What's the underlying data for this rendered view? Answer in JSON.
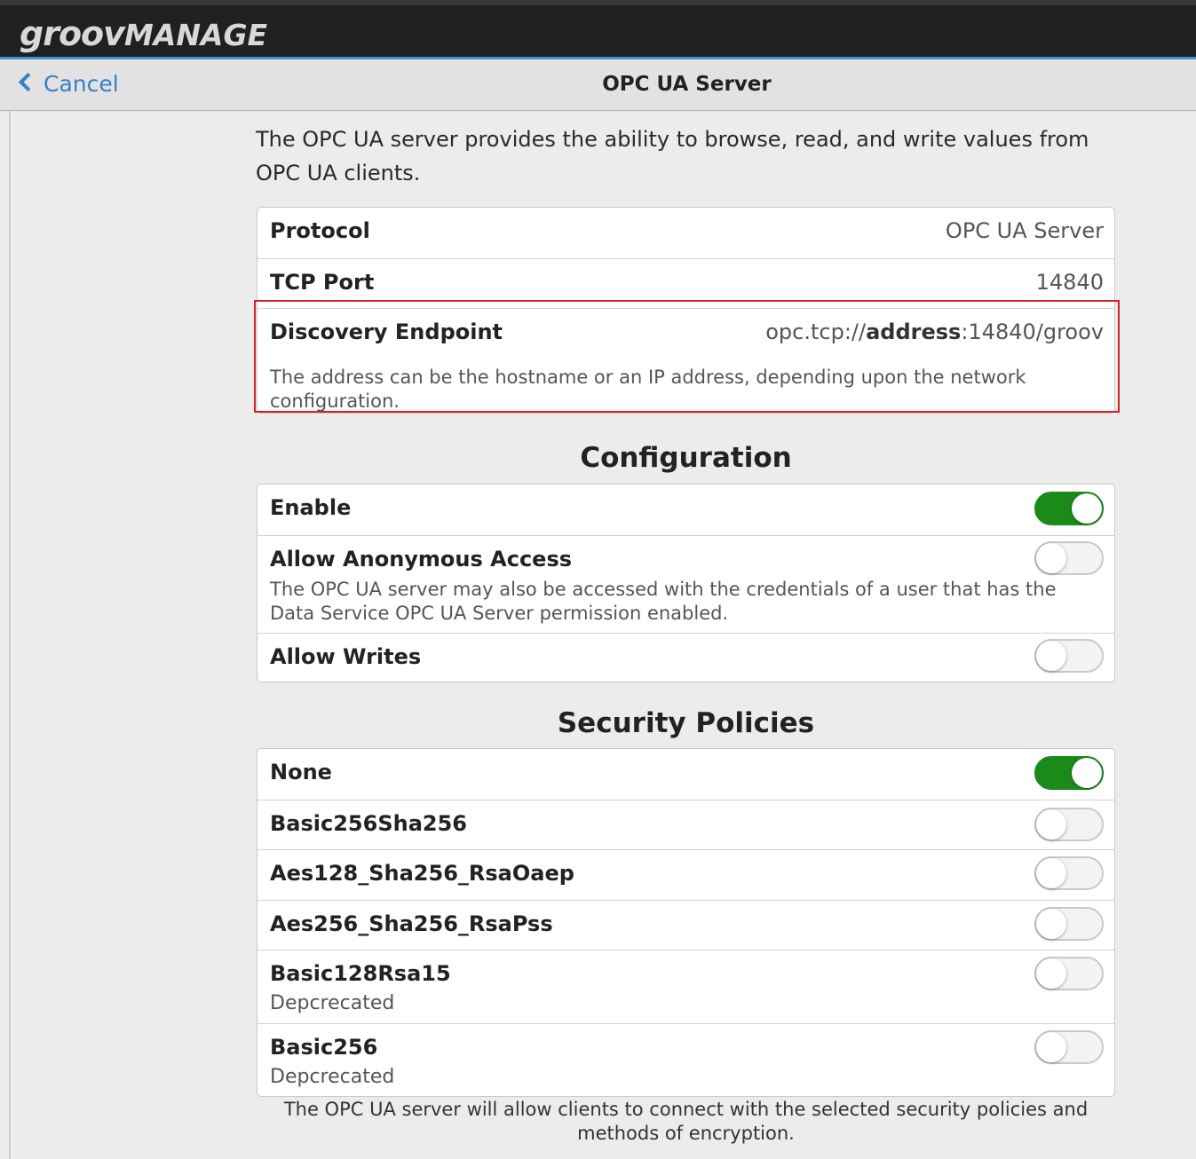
{
  "app": {
    "logo_part1": "groov",
    "logo_part2": "MANAGE"
  },
  "nav": {
    "cancel_label": "Cancel",
    "title": "OPC UA Server"
  },
  "intro": "The OPC UA server provides the ability to browse, read, and write values from OPC UA clients.",
  "info": {
    "protocol": {
      "label": "Protocol",
      "value": "OPC UA Server"
    },
    "tcp_port": {
      "label": "TCP Port",
      "value": "14840"
    },
    "discovery": {
      "label": "Discovery Endpoint",
      "value_prefix": "opc.tcp://",
      "value_bold": "address",
      "value_suffix": ":14840/groov",
      "description": "The address can be the hostname or an IP address, depending upon the network configuration."
    }
  },
  "configuration": {
    "title": "Configuration",
    "items": [
      {
        "label": "Enable",
        "enabled": true
      },
      {
        "label": "Allow Anonymous Access",
        "enabled": false,
        "description": "The OPC UA server may also be accessed with the credentials of a user that has the Data Service OPC UA Server permission enabled."
      },
      {
        "label": "Allow Writes",
        "enabled": false
      }
    ]
  },
  "security": {
    "title": "Security Policies",
    "items": [
      {
        "label": "None",
        "enabled": true
      },
      {
        "label": "Basic256Sha256",
        "enabled": false
      },
      {
        "label": "Aes128_Sha256_RsaOaep",
        "enabled": false
      },
      {
        "label": "Aes256_Sha256_RsaPss",
        "enabled": false
      },
      {
        "label": "Basic128Rsa15",
        "enabled": false,
        "note": "Depcrecated"
      },
      {
        "label": "Basic256",
        "enabled": false,
        "note": "Depcrecated"
      }
    ],
    "footnote": "The OPC UA server will allow clients to connect with the selected security policies and methods of encryption."
  },
  "colors": {
    "accent": "#3a7fc8",
    "toggle_on": "#1a8a1a",
    "highlight": "#d42020",
    "topbar": "#202020"
  }
}
